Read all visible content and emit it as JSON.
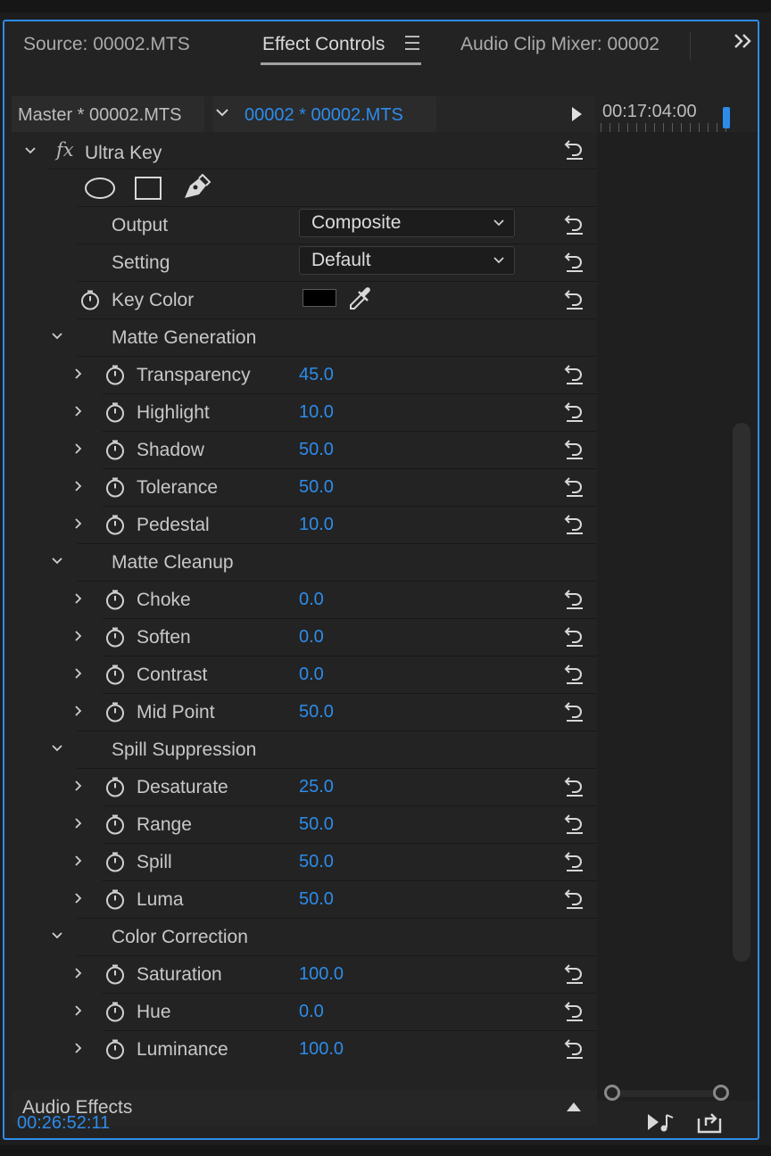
{
  "tabs": {
    "source": "Source: 00002.MTS",
    "effect_controls": "Effect Controls",
    "audio_clip_mixer": "Audio Clip Mixer: 00002"
  },
  "clip_bar": {
    "master": "Master * 00002.MTS",
    "sequence": "00002 * 00002.MTS"
  },
  "timeline": {
    "timecode": "00:17:04:00"
  },
  "effect": {
    "name": "Ultra Key",
    "output_label": "Output",
    "output_value": "Composite",
    "setting_label": "Setting",
    "setting_value": "Default",
    "key_color_label": "Key Color",
    "key_color_value": "#000000"
  },
  "groups": {
    "matte_generation": {
      "label": "Matte Generation",
      "params": [
        {
          "label": "Transparency",
          "value": "45.0"
        },
        {
          "label": "Highlight",
          "value": "10.0"
        },
        {
          "label": "Shadow",
          "value": "50.0"
        },
        {
          "label": "Tolerance",
          "value": "50.0"
        },
        {
          "label": "Pedestal",
          "value": "10.0"
        }
      ]
    },
    "matte_cleanup": {
      "label": "Matte Cleanup",
      "params": [
        {
          "label": "Choke",
          "value": "0.0"
        },
        {
          "label": "Soften",
          "value": "0.0"
        },
        {
          "label": "Contrast",
          "value": "0.0"
        },
        {
          "label": "Mid Point",
          "value": "50.0"
        }
      ]
    },
    "spill_suppression": {
      "label": "Spill Suppression",
      "params": [
        {
          "label": "Desaturate",
          "value": "25.0"
        },
        {
          "label": "Range",
          "value": "50.0"
        },
        {
          "label": "Spill",
          "value": "50.0"
        },
        {
          "label": "Luma",
          "value": "50.0"
        }
      ]
    },
    "color_correction": {
      "label": "Color Correction",
      "params": [
        {
          "label": "Saturation",
          "value": "100.0"
        },
        {
          "label": "Hue",
          "value": "0.0"
        },
        {
          "label": "Luminance",
          "value": "100.0"
        }
      ]
    }
  },
  "footer": {
    "audio_effects": "Audio Effects",
    "timecode": "00:26:52:11"
  },
  "colors": {
    "accent": "#2d8ceb",
    "panel_bg": "#232323",
    "text": "#c8c8c8"
  }
}
